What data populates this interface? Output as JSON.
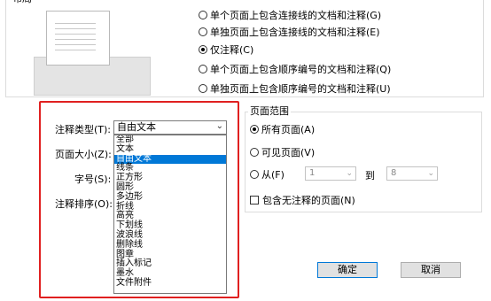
{
  "layout_group": {
    "legend": "布局"
  },
  "print_options": [
    {
      "label": "单个页面上包含连接线的文档和注释(G)",
      "checked": false
    },
    {
      "label": "单独页面上包含连接线的文档和注释(E)",
      "checked": false
    },
    {
      "label": "仅注释(C)",
      "checked": true
    },
    {
      "label": "单个页面上包含顺序编号的文档和注释(Q)",
      "checked": false
    },
    {
      "label": "单独页面上包含顺序编号的文档和注释(U)",
      "checked": false
    }
  ],
  "annotation_type": {
    "label": "注释类型(T):",
    "selected": "自由文本",
    "options": [
      "全部",
      "文本",
      "自由文本",
      "线条",
      "正方形",
      "圆形",
      "多边形",
      "折线",
      "高亮",
      "下划线",
      "波浪线",
      "删除线",
      "图章",
      "插入标记",
      "墨水",
      "文件附件"
    ]
  },
  "page_size_label": "页面大小(Z):",
  "font_size_label": "字号(S):",
  "sort_label": "注释排序(O):",
  "page_range": {
    "legend": "页面范围",
    "all_pages": "所有页面(A)",
    "visible_pages": "可见页面(V)",
    "from_label": "从(F)",
    "from_value": "1",
    "to_label": "到",
    "to_value": "8",
    "include_no_annotation": "包含无注释的页面(N)"
  },
  "buttons": {
    "ok": "确定",
    "cancel": "取消"
  }
}
